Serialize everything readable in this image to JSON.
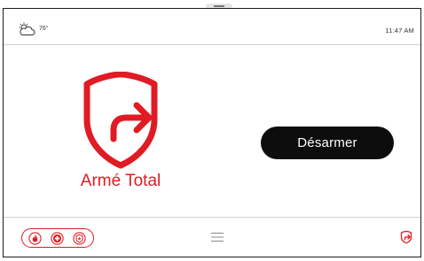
{
  "status_bar": {
    "weather_icon": "cloud-sun-icon",
    "temperature": "76",
    "temperature_unit": "°",
    "time": "11:47 AM"
  },
  "arm_status": {
    "icon": "shield-exit-arrow-icon",
    "label": "Armé Total",
    "color": "#e01b24"
  },
  "actions": {
    "disarm_label": "Désarmer"
  },
  "bottom_bar": {
    "panic_buttons": [
      "fire-icon",
      "medical-icon",
      "police-icon"
    ],
    "menu_icon": "hamburger-menu-icon",
    "status_icon": "shield-exit-arrow-icon"
  },
  "colors": {
    "accent": "#e01b24",
    "button_bg": "#0d0d0d",
    "button_text": "#ffffff"
  }
}
